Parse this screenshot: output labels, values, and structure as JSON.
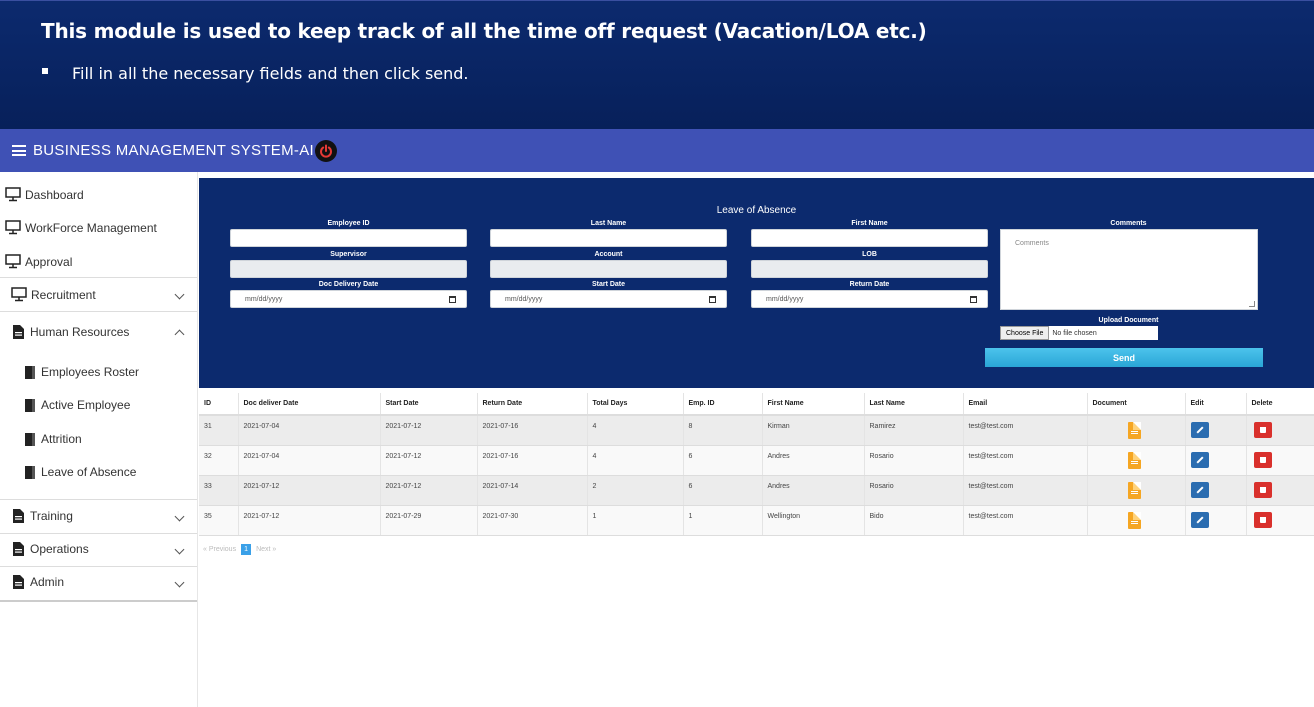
{
  "banner": {
    "title": "This module is used to keep track of all the time off request (Vacation/LOA etc.)",
    "bullet": "Fill in all the necessary fields and then click send."
  },
  "appbar": {
    "title": "BUSINESS MANAGEMENT SYSTEM-AI",
    "menu_icon": "hamburger-icon",
    "power_icon": "power-icon",
    "colors": {
      "bar": "#3f51b5",
      "power": "#e53935"
    }
  },
  "sidebar": {
    "items": [
      {
        "label": "Dashboard",
        "icon": "monitor-icon"
      },
      {
        "label": "WorkForce Management",
        "icon": "monitor-icon"
      },
      {
        "label": "Approval",
        "icon": "monitor-icon"
      },
      {
        "label": "Recruitment",
        "icon": "monitor-icon",
        "chevron": "down"
      },
      {
        "label": "Human Resources",
        "icon": "document-icon",
        "chevron": "up"
      },
      {
        "label": "Employees Roster",
        "icon": "book-icon"
      },
      {
        "label": "Active Employee",
        "icon": "book-icon"
      },
      {
        "label": "Attrition",
        "icon": "book-icon"
      },
      {
        "label": "Leave of Absence",
        "icon": "book-icon"
      },
      {
        "label": "Training",
        "icon": "document-icon",
        "chevron": "down"
      },
      {
        "label": "Operations",
        "icon": "document-icon",
        "chevron": "down"
      },
      {
        "label": "Admin",
        "icon": "document-icon",
        "chevron": "down"
      }
    ]
  },
  "form": {
    "title": "Leave of Absence",
    "employee_id": "Employee ID",
    "last_name": "Last Name",
    "first_name": "First Name",
    "comments_label": "Comments",
    "comments_placeholder": "Comments",
    "supervisor": "Supervisor",
    "account": "Account",
    "lob": "LOB",
    "doc_delivery_date": "Doc Delivery Date",
    "start_date": "Start Date",
    "return_date": "Return Date",
    "date_placeholder": "mm/dd/yyyy",
    "upload_label": "Upload Document",
    "choose_file": "Choose File",
    "no_file": "No file chosen",
    "send": "Send"
  },
  "table": {
    "headers": [
      "ID",
      "Doc deliver Date",
      "Start Date",
      "Return Date",
      "Total Days",
      "Emp. ID",
      "First Name",
      "Last Name",
      "Email",
      "Document",
      "Edit",
      "Delete"
    ],
    "rows": [
      [
        "31",
        "2021-07-04",
        "2021-07-12",
        "2021-07-16",
        "4",
        "8",
        "Kirman",
        "Ramirez",
        "test@test.com"
      ],
      [
        "32",
        "2021-07-04",
        "2021-07-12",
        "2021-07-16",
        "4",
        "6",
        "Andres",
        "Rosario",
        "test@test.com"
      ],
      [
        "33",
        "2021-07-12",
        "2021-07-12",
        "2021-07-14",
        "2",
        "6",
        "Andres",
        "Rosario",
        "test@test.com"
      ],
      [
        "35",
        "2021-07-12",
        "2021-07-29",
        "2021-07-30",
        "1",
        "1",
        "Wellington",
        "Bido",
        "test@test.com"
      ]
    ]
  },
  "pager": {
    "previous": "« Previous",
    "page": "1",
    "next": "Next »"
  }
}
